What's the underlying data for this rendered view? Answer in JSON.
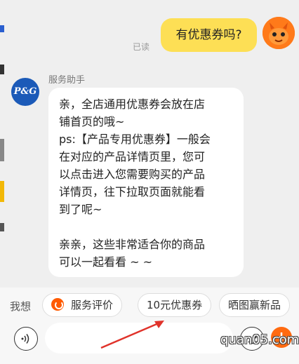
{
  "outgoing": {
    "text": "有优惠券吗?",
    "status": "已读"
  },
  "incoming": {
    "sender": "服务助手",
    "avatar_text": "P&G",
    "paragraphs": [
      "亲，全店通用优惠券会放在店\n铺首页的哦~\nps:【产品专用优惠券】一般会\n在对应的产品详情页里，您可\n以点击进入您需要购买的产品\n详情页，往下拉取页面就能看\n到了呢~",
      "亲亲，这些非常适合你的商品\n可以一起看看 ~ ~"
    ]
  },
  "quick_replies": {
    "label": "我想",
    "chips": [
      "服务评价",
      "10元优惠券",
      "晒图赢新品"
    ]
  },
  "input": {
    "placeholder": ""
  },
  "watermark": "quan05.com",
  "colors": {
    "accent": "#ff6a10",
    "bubble_out": "#fddf55",
    "arrow": "#e0322a"
  },
  "icons": {
    "voice": "voice-icon",
    "emoji": "emoji-icon",
    "plus": "plus-icon",
    "service": "service-rating-icon"
  }
}
